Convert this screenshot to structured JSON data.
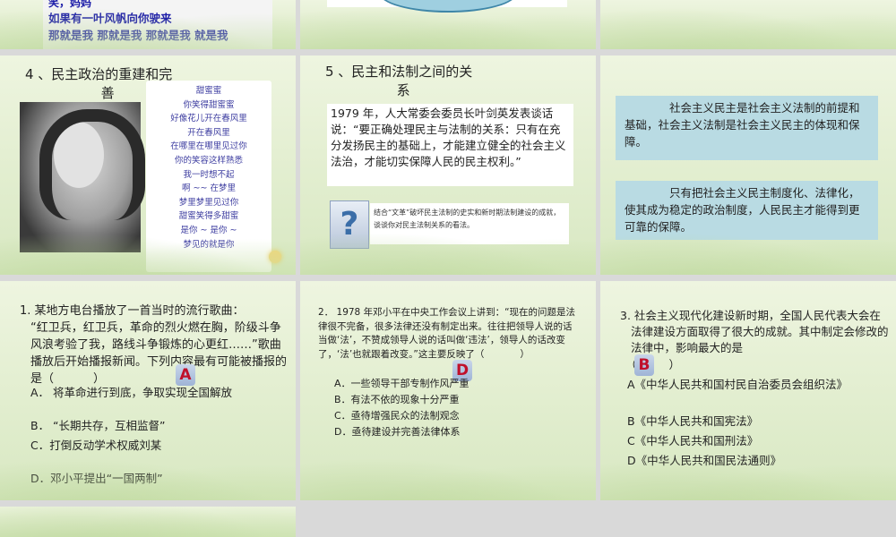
{
  "s1": {
    "line1": "笑，妈妈",
    "line2": "如果有一叶风帆向你驶来",
    "line3": "那就是我 那就是我 那就是我 就是我"
  },
  "s4": {
    "title_a": "4 、民主政治的重建和完",
    "title_b": "善",
    "lyrics": [
      "甜蜜蜜",
      "你笑得甜蜜蜜",
      "好像花儿开在春风里",
      "开在春风里",
      "在哪里在哪里见过你",
      "你的笑容这样熟悉",
      "我一时想不起",
      "啊 ~~ 在梦里",
      "梦里梦里见过你",
      "甜蜜笑得多甜蜜",
      "是你 ~ 是你 ~",
      "梦见的就是你"
    ]
  },
  "s5": {
    "title_a": "5 、民主和法制之间的关",
    "title_b": "系",
    "quote": "1979 年，人大常委会委员长叶剑英发表谈话说：“要正确处理民主与法制的关系：只有在充分发扬民主的基础上，才能建立健全的社会主义法治，才能切实保障人民的民主权利。”",
    "qmark": "?",
    "task": "结合“文革”破坏民主法制的史实和新时期法制建设的成就，谈谈你对民主法制关系的看法。"
  },
  "s6": {
    "p1": "社会主义民主是社会主义法制的前提和基础，社会主义法制是社会主义民主的体现和保障。",
    "p2": "只有把社会主义民主制度化、法律化，使其成为稳定的政治制度，人民民主才能得到更可靠的保障。"
  },
  "q1": {
    "stem_a": "1. 某地方电台播放了一首当时的流行歌曲：",
    "stem_b": "“红卫兵，红卫兵，革命的烈火燃在胸，阶级斗争风浪考验了我，路线斗争锻炼的心更红……”歌曲播放后开始播报新闻。下列内容最有可能被播报的是（",
    "paren_close": "）",
    "answer": "A",
    "options": [
      "A． 将革命进行到底，争取实现全国解放",
      "B． “长期共存，互相监督”",
      "C．打倒反动学术权威刘某",
      "D．邓小平提出“一国两制”"
    ]
  },
  "q2": {
    "stem": "2． 1978 年邓小平在中央工作会议上讲到：“现在的问题是法律很不完备，很多法律还没有制定出来。往往把领导人说的话当做‘法’，不赞成领导人说的话叫做‘违法’，领导人的话改变了，‘法’也就跟着改变。”这主要反映了（",
    "paren_close": "）",
    "answer": "D",
    "options": [
      "A．一些领导干部专制作风严重",
      "B．有法不依的现象十分严重",
      "C．亟待增强民众的法制观念",
      "D．亟待建设并完善法律体系"
    ]
  },
  "q3": {
    "stem": "3. 社会主义现代化建设新时期，全国人民代表大会在法律建设方面取得了很大的成就。其中制定会修改的法律中，影响最大的是",
    "paren_open": "（",
    "paren_close": "）",
    "answer": "B",
    "options": [
      "A《中华人民共和国村民自治委员会组织法》",
      "B《中华人民共和国宪法》",
      "C《中华人民共和国刑法》",
      "D《中华人民共和国民法通则》"
    ]
  },
  "colors": {
    "blue_box": "#b9dbe3",
    "answer_red": "#c0102a",
    "slide_green": "#e4efd2"
  }
}
